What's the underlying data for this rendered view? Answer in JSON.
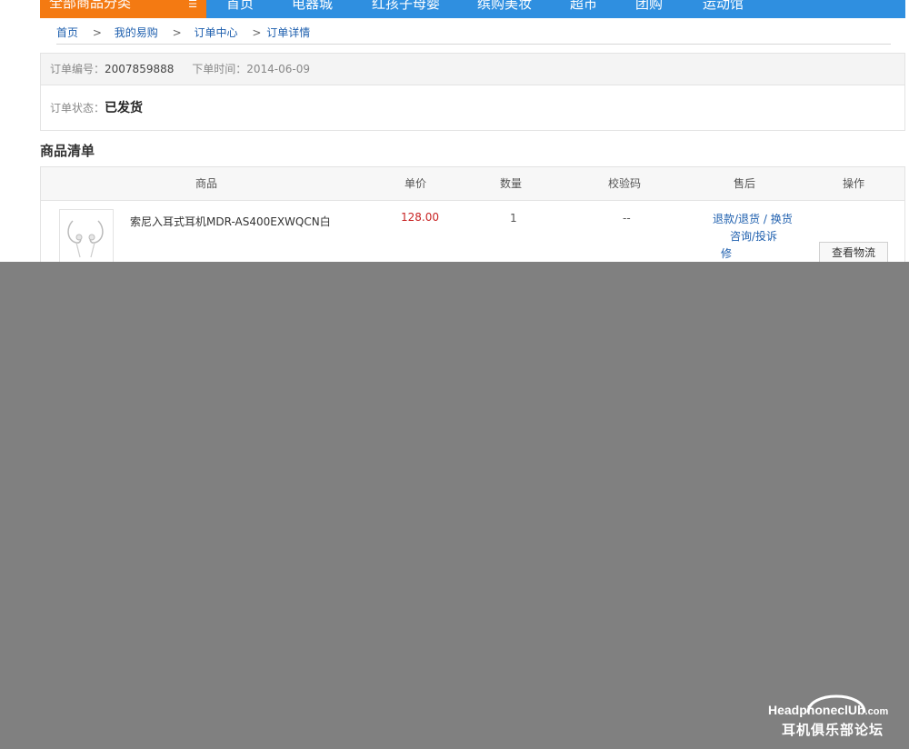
{
  "nav": {
    "category_label": "全部商品分类",
    "category_icon": "menu-icon",
    "items": [
      "首页",
      "电器城",
      "红孩子母婴",
      "缤购美妆",
      "超市",
      "团购",
      "运动馆"
    ]
  },
  "breadcrumb": {
    "items": [
      "首页",
      "我的易购",
      "订单中心",
      "订单详情"
    ],
    "separator": ">"
  },
  "order": {
    "number_label": "订单编号：",
    "number": "2007859888",
    "time_label": "下单时间：",
    "time": "2014-06-09",
    "status_label": "订单状态：",
    "status": "已发货"
  },
  "products": {
    "title": "商品清单",
    "columns": [
      "商品",
      "单价",
      "数量",
      "校验码",
      "售后",
      "操作"
    ],
    "rows": [
      {
        "name": "索尼入耳式耳机MDR-AS400EXWQCN白",
        "price": "128.00",
        "quantity": "1",
        "code": "--",
        "service_1": "退款/退货 / 换货",
        "service_2": "咨询/投诉",
        "service_3": "修",
        "action": "查看物流"
      }
    ]
  },
  "watermark": {
    "line1_main": "HeadphoneclUb",
    "line1_suffix": ".com",
    "line2": "耳机俱乐部论坛"
  },
  "colors": {
    "nav_blue": "#2f8fe0",
    "category_orange": "#f47a12",
    "link_blue": "#1e5fae",
    "price_red": "#c82323",
    "overlay_gray": "#808080"
  }
}
